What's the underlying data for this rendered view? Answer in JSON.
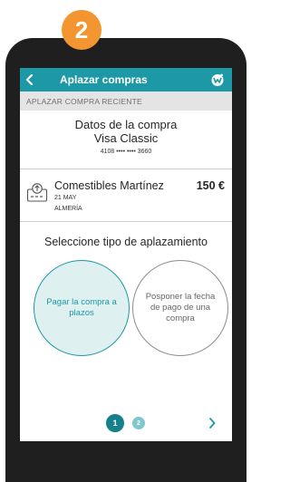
{
  "step_badge": "2",
  "header": {
    "title": "Aplazar compras",
    "brand_icon": "wizink-logo-icon",
    "back_icon": "chevron-left-icon"
  },
  "section": {
    "label": "APLAZAR COMPRA RECIENTE"
  },
  "purchase": {
    "title": "Datos de la compra",
    "card_name": "Visa Classic",
    "card_number": "4108 •••• •••• 3660"
  },
  "transaction": {
    "icon": "receipt-upload-icon",
    "merchant": "Comestibles Martínez",
    "amount": "150 €",
    "date": "21 MAY",
    "city": "ALMERÍA"
  },
  "selection": {
    "title": "Seleccione tipo de aplazamiento",
    "option_installments": "Pagar la compra a plazos",
    "option_postpone": "Posponer la fecha de pago de una compra",
    "selected": "option_installments"
  },
  "pager": {
    "page_1": "1",
    "page_2": "2",
    "current": 1,
    "next_icon": "chevron-right-icon"
  },
  "colors": {
    "accent": "#1c98a6",
    "badge": "#f39530",
    "phone_frame": "#1f1f1f"
  }
}
